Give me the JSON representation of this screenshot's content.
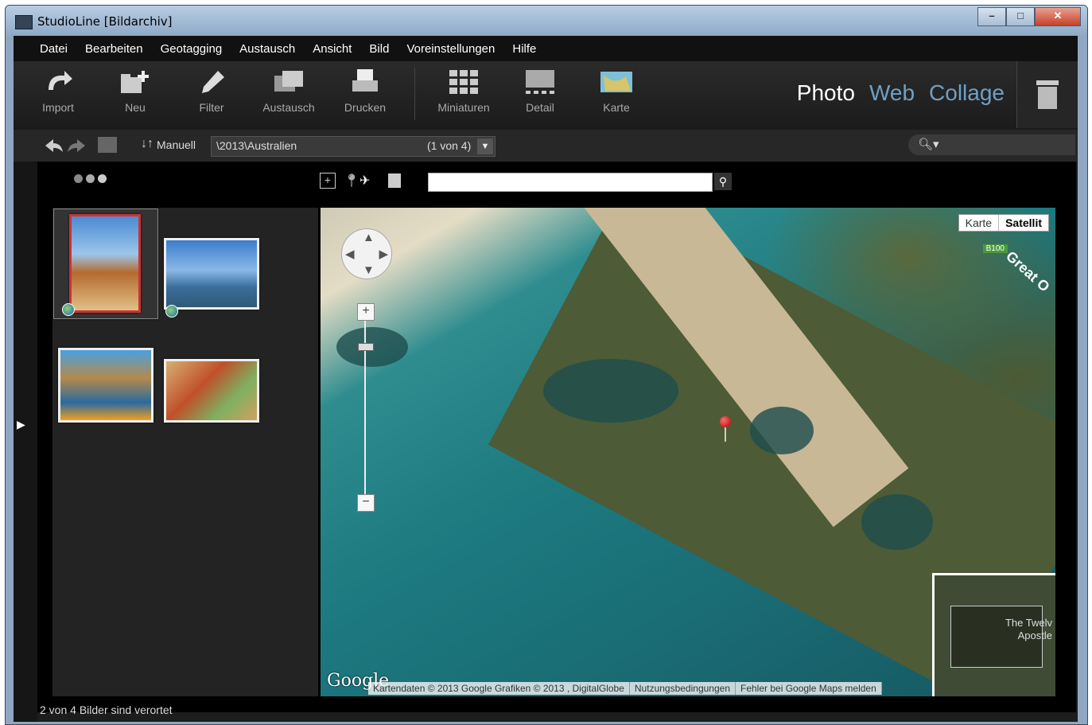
{
  "window": {
    "title": "StudioLine [Bildarchiv]",
    "controls": [
      "–",
      "□",
      "✕"
    ]
  },
  "menu": [
    "Datei",
    "Bearbeiten",
    "Geotagging",
    "Austausch",
    "Ansicht",
    "Bild",
    "Voreinstellungen",
    "Hilfe"
  ],
  "toolbar": {
    "tools": [
      {
        "label": "Import",
        "icon": "import-icon"
      },
      {
        "label": "Neu",
        "icon": "new-folder-icon"
      },
      {
        "label": "Filter",
        "icon": "filter-icon"
      },
      {
        "label": "Austausch",
        "icon": "exchange-icon"
      },
      {
        "label": "Drucken",
        "icon": "print-icon"
      },
      {
        "label": "Miniaturen",
        "icon": "thumbnails-icon"
      },
      {
        "label": "Detail",
        "icon": "detail-icon"
      },
      {
        "label": "Karte",
        "icon": "map-icon"
      }
    ],
    "modes": [
      "Photo",
      "Web",
      "Collage"
    ],
    "active_mode": "Photo"
  },
  "nav": {
    "sort_label": "Manuell",
    "path": "\\2013\\Australien",
    "count": "(1 von 4)"
  },
  "map": {
    "type_options": [
      "Karte",
      "Satellit"
    ],
    "active_type": "Satellit",
    "road_badge": "B100",
    "road_label": "Great O",
    "overview_label_line1": "The Twelv",
    "overview_label_line2": "Apostle",
    "google": "Google",
    "attribution": [
      "Kartendaten © 2013 Google Grafiken © 2013 , DigitalGlobe",
      "Nutzungsbedingungen",
      "Fehler bei Google Maps melden"
    ],
    "zoom_plus": "+",
    "zoom_minus": "−"
  },
  "status": "2 von 4 Bilder sind verortet"
}
